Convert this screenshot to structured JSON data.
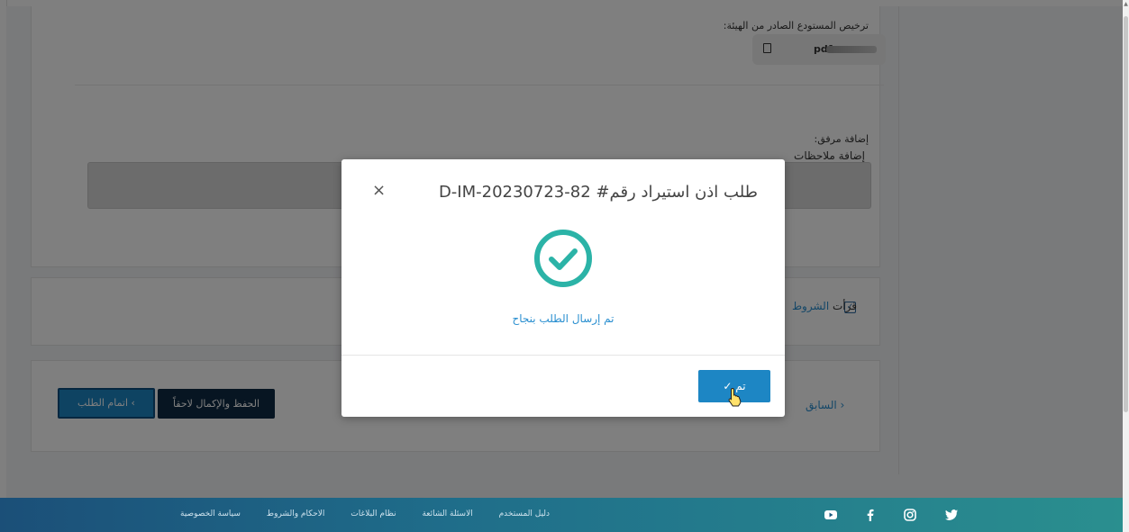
{
  "form": {
    "warehouse_license_label": "ترخيص المستودع الصادر من الهيئة:",
    "file_name": "pdf.٤",
    "add_attachment_label": "إضافة مرفق:",
    "add_notes_label": "إضافة ملاحظات",
    "terms_prefix": "قرأت",
    "terms_link": "الشروط"
  },
  "buttons": {
    "complete_request": "اتمام الطلب",
    "save_later": "الحفظ والإكمال لاحقاً",
    "previous": "السابق"
  },
  "modal": {
    "title": "طلب اذن استيراد رقم# D-IM-20230723-82",
    "close": "×",
    "success_message": "تم إرسال الطلب بنجاح",
    "ok_label": "تم"
  },
  "footer": {
    "links": [
      "سياسة الخصوصية",
      "الاحكام والشروط",
      "نظام البلاغات",
      "الاسئلة الشائعة",
      "دليل المستخدم"
    ],
    "social": [
      "youtube-icon",
      "facebook-icon",
      "instagram-icon",
      "twitter-icon"
    ]
  },
  "colors": {
    "accent": "#1d86c4",
    "success": "#2bb3a7",
    "link": "#2a8fd0",
    "dark_button": "#0f2a44"
  }
}
